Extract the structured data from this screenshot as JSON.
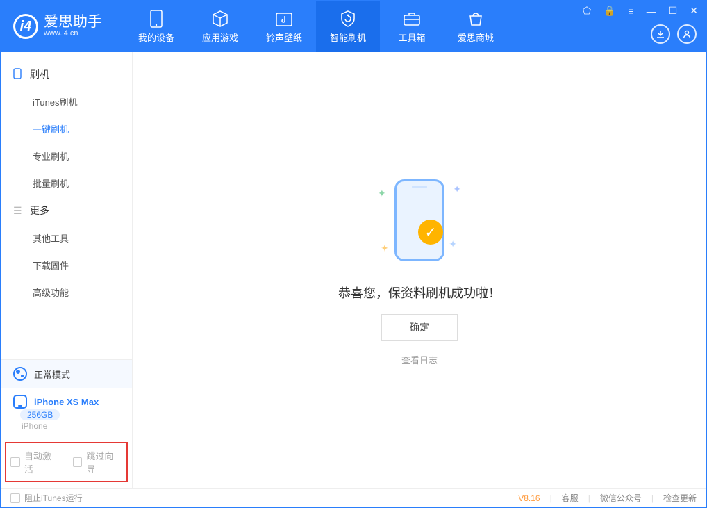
{
  "app": {
    "name": "爱思助手",
    "site": "www.i4.cn"
  },
  "nav": {
    "tabs": [
      {
        "label": "我的设备"
      },
      {
        "label": "应用游戏"
      },
      {
        "label": "铃声壁纸"
      },
      {
        "label": "智能刷机"
      },
      {
        "label": "工具箱"
      },
      {
        "label": "爱思商城"
      }
    ]
  },
  "sidebar": {
    "group1": {
      "title": "刷机",
      "items": [
        "iTunes刷机",
        "一键刷机",
        "专业刷机",
        "批量刷机"
      ],
      "activeIndex": 1
    },
    "group2": {
      "title": "更多",
      "items": [
        "其他工具",
        "下载固件",
        "高级功能"
      ]
    }
  },
  "device": {
    "mode": "正常模式",
    "name": "iPhone XS Max",
    "capacity": "256GB",
    "type": "iPhone"
  },
  "options": {
    "auto_activate": "自动激活",
    "skip_guide": "跳过向导"
  },
  "main": {
    "success_text": "恭喜您，保资料刷机成功啦！",
    "confirm": "确定",
    "view_log": "查看日志"
  },
  "footer": {
    "block_itunes": "阻止iTunes运行",
    "version": "V8.16",
    "links": [
      "客服",
      "微信公众号",
      "检查更新"
    ]
  }
}
